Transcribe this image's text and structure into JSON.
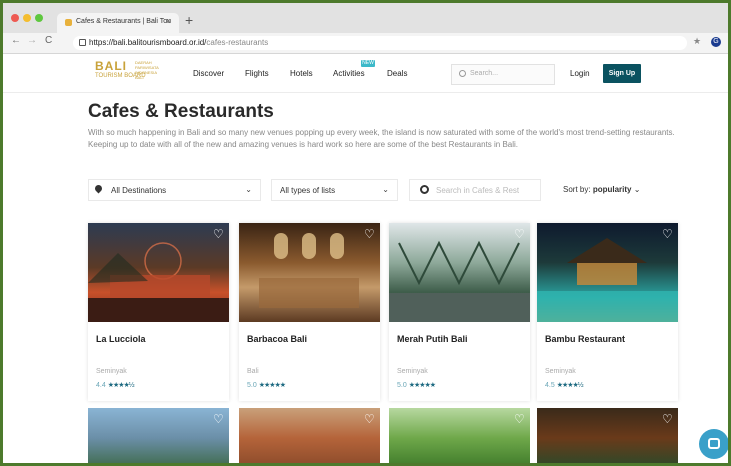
{
  "browser": {
    "tab_title": "Cafes & Restaurants | Bali Tou",
    "tab_close": "×",
    "new_tab": "+",
    "back": "←",
    "forward": "→",
    "reload": "C",
    "url_host": "https://bali.balitourismboard.or.id/",
    "url_path": "cafes-restaurants",
    "bookmark_icon": "★",
    "profile_initial": "G"
  },
  "header": {
    "logo_text": "BALI",
    "logo_sub": "TOURISM BOARD",
    "logo_jp": "DAERAH PARIWISATA INDONESIA BALI",
    "nav": [
      "Discover",
      "Flights",
      "Hotels",
      "Activities",
      "Deals"
    ],
    "new_badge": "NEW",
    "search_placeholder": "Search...",
    "login": "Login",
    "signup": "Sign Up"
  },
  "page": {
    "title": "Cafes & Restaurants",
    "intro": "With so much happening in Bali and so many new venues popping up every week, the island is now saturated with some of the world's most trend-setting restaurants. Keeping up to date with all of the new and amazing venues is hard work so here are some of the best Restaurants in Bali."
  },
  "filters": {
    "destination": "All Destinations",
    "list_type": "All types of lists",
    "search_placeholder": "Search in Cafes & Rest",
    "sort_label": "Sort by:",
    "sort_value": "popularity"
  },
  "cards": [
    {
      "title": "La Lucciola",
      "location": "Seminyak",
      "rating": "4.4",
      "stars": "★★★★½"
    },
    {
      "title": "Barbacoa Bali",
      "location": "Bali",
      "rating": "5.0",
      "stars": "★★★★★"
    },
    {
      "title": "Merah Putih Bali",
      "location": "Seminyak",
      "rating": "5.0",
      "stars": "★★★★★"
    },
    {
      "title": "Bambu Restaurant",
      "location": "Seminyak",
      "rating": "4.5",
      "stars": "★★★★½"
    }
  ],
  "colors": {
    "accent": "#0a5260",
    "logo_gold": "#c8a23a",
    "badge": "#3cb9c9",
    "chat": "#3aa0c9",
    "frame": "#4d7a2c"
  },
  "icons": [
    "pin-icon",
    "chevron-down-icon",
    "search-icon",
    "heart-icon",
    "chat-icon",
    "lock-icon",
    "star-icon"
  ]
}
